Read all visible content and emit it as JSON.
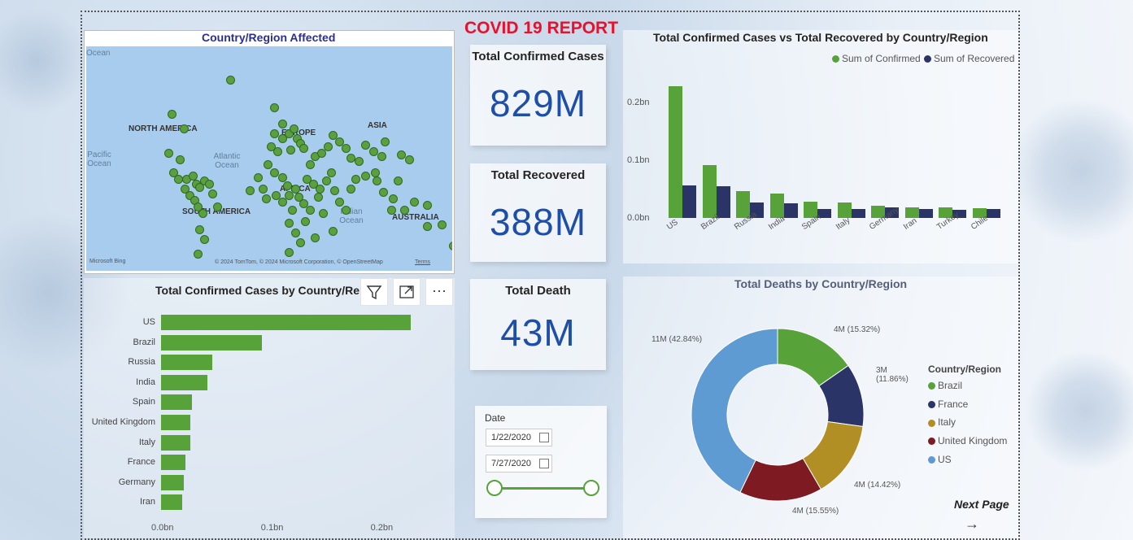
{
  "report_title": "COVID 19 REPORT",
  "map": {
    "title": "Country/Region Affected",
    "labels": {
      "north_america": "NORTH AMERICA",
      "south_america": "SOUTH AMERICA",
      "europe": "EUROPE",
      "asia": "ASIA",
      "africa": "AFRICA",
      "australia": "AUSTRALIA",
      "atlantic": "Atlantic Ocean",
      "pacific": "Pacific Ocean",
      "indian": "Indian Ocean",
      "ocean_top": "Ocean"
    },
    "bing": "Microsoft Bing",
    "copyright": "© 2024 TomTom, © 2024 Microsoft Corporation, © OpenStreetMap",
    "terms": "Terms"
  },
  "cards": {
    "confirmed": {
      "label": "Total Confirmed Cases",
      "value": "829M"
    },
    "recovered": {
      "label": "Total Recovered",
      "value": "388M"
    },
    "death": {
      "label": "Total Death",
      "value": "43M"
    }
  },
  "date_slicer": {
    "label": "Date",
    "start": "1/22/2020",
    "end": "7/27/2020"
  },
  "next_page": {
    "label": "Next Page",
    "arrow": "→"
  },
  "toolbar": {
    "filter_icon": "filter-icon",
    "focus_icon": "focus-mode-icon",
    "more_icon": "more-options-icon",
    "more_glyph": "···"
  },
  "colors": {
    "green": "#57a239",
    "navy": "#2b3467",
    "olive": "#b18f25",
    "maroon": "#7e1b22",
    "lightblue": "#5e9bd3",
    "title_red": "#e8112d",
    "value_blue": "#1e4fa8"
  },
  "chart_data": [
    {
      "type": "bar",
      "orientation": "horizontal",
      "title": "Total Confirmed Cases by Country/Re",
      "categories": [
        "US",
        "Brazil",
        "Russia",
        "India",
        "Spain",
        "United Kingdom",
        "Italy",
        "France",
        "Germany",
        "Iran"
      ],
      "values": [
        0.228,
        0.092,
        0.047,
        0.042,
        0.028,
        0.027,
        0.027,
        0.022,
        0.021,
        0.019
      ],
      "xticks": [
        "0.0bn",
        "0.1bn",
        "0.2bn"
      ],
      "xlim": [
        0,
        0.25
      ]
    },
    {
      "type": "bar",
      "title": "Total Confirmed Cases vs Total Recovered by Country/Region",
      "categories": [
        "US",
        "Brazil",
        "Russia",
        "India",
        "Spain",
        "Italy",
        "Germany",
        "Iran",
        "Turkey",
        "Chile"
      ],
      "series": [
        {
          "name": "Sum of Confirmed",
          "values": [
            0.228,
            0.092,
            0.047,
            0.042,
            0.028,
            0.027,
            0.021,
            0.019,
            0.018,
            0.017
          ]
        },
        {
          "name": "Sum of Recovered",
          "values": [
            0.057,
            0.055,
            0.027,
            0.025,
            0.015,
            0.016,
            0.018,
            0.015,
            0.014,
            0.015
          ]
        }
      ],
      "yticks": [
        "0.0bn",
        "0.1bn",
        "0.2bn"
      ],
      "ylim": [
        0,
        0.25
      ],
      "legend": "top-right"
    },
    {
      "type": "pie",
      "donut": true,
      "title": "Total Deaths by Country/Region",
      "legend_title": "Country/Region",
      "categories": [
        "Brazil",
        "France",
        "Italy",
        "United Kingdom",
        "US"
      ],
      "values": [
        15.32,
        11.86,
        14.42,
        15.55,
        42.84
      ],
      "labels": [
        "4M (15.32%)",
        "3M (11.86%)",
        "4M (14.42%)",
        "4M (15.55%)",
        "11M (42.84%)"
      ],
      "colors": [
        "#57a239",
        "#2b3467",
        "#b18f25",
        "#7e1b22",
        "#5e9bd3"
      ],
      "legend": "right"
    }
  ]
}
